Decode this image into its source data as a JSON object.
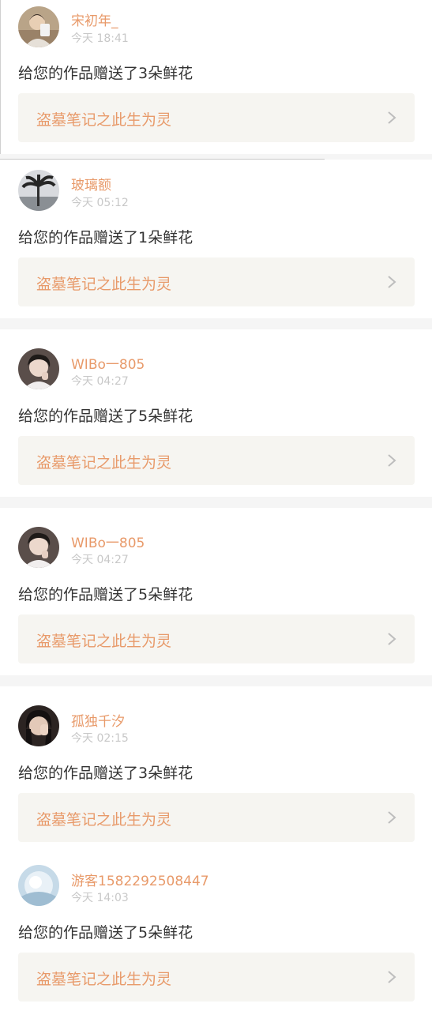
{
  "feed": {
    "items": [
      {
        "username": "宋初年_",
        "time": "今天 18:41",
        "message": "给您的作品赠送了3朵鲜花",
        "work_title": "盗墓笔记之此生为灵",
        "avatar_icon": "avatar-person-phone"
      },
      {
        "username": "玻璃额",
        "time": "今天 05:12",
        "message": "给您的作品赠送了1朵鲜花",
        "work_title": "盗墓笔记之此生为灵",
        "avatar_icon": "avatar-palm-tree"
      },
      {
        "username": "WIBo一805",
        "time": "今天 04:27",
        "message": "给您的作品赠送了5朵鲜花",
        "work_title": "盗墓笔记之此生为灵",
        "avatar_icon": "avatar-young-man"
      },
      {
        "username": "WIBo一805",
        "time": "今天 04:27",
        "message": "给您的作品赠送了5朵鲜花",
        "work_title": "盗墓笔记之此生为灵",
        "avatar_icon": "avatar-young-man"
      },
      {
        "username": "孤独千汐",
        "time": "今天 02:15",
        "message": "给您的作品赠送了3朵鲜花",
        "work_title": "盗墓笔记之此生为灵",
        "avatar_icon": "avatar-girl-hand"
      },
      {
        "username": "游客1582292508447",
        "time": "今天 14:03",
        "message": "给您的作品赠送了5朵鲜花",
        "work_title": "盗墓笔记之此生为灵",
        "avatar_icon": "avatar-default-guest"
      }
    ]
  },
  "colors": {
    "accent": "#e89a6a",
    "text": "#333333",
    "muted": "#c8c8c8",
    "card_bg": "#f6f5f1",
    "divider": "#f5f5f5"
  }
}
